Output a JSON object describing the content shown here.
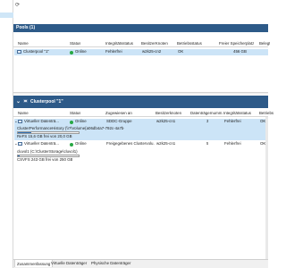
{
  "toolbar": {
    "refresh_icon": "refresh-icon"
  },
  "pools_panel": {
    "title": "Pools (1)",
    "columns": [
      "Name",
      "Status",
      "Integritätsstatus",
      "BesitzerKnoten",
      "Betriebsstatus",
      "Freier Speicherplatz",
      "Belegt"
    ],
    "rows": [
      {
        "name": "Clusterpool \"1\"",
        "status": "Online",
        "integrity": "Fehlerfrei",
        "owner": "w2k25-cn2",
        "opstatus": "OK",
        "free": "456 GB"
      }
    ]
  },
  "detail_panel": {
    "title": "Clusterpool \"1\"",
    "columns": [
      "Name",
      "Status",
      "Zugewiesen an",
      "Besitzerknoten",
      "Datenträgernumm...",
      "Integritätsstatus",
      "Betriebs"
    ],
    "disks": [
      {
        "name": "Virtueller Datenträ...",
        "status": "Online",
        "assigned": "SDDC-Gruppe",
        "owner": "w2k25-cn1",
        "number": "3",
        "integrity": "Fehlerfrei",
        "opstatus": "OK",
        "path": "ClusterPerformanceHistory (\\\\?\\Volume{a06db4a7-792c-4a7b-9cda-646cd7f5429c}\\)",
        "capacity_text": "ReFS 15,6 GB frei von 20,0 GB",
        "fill_fraction": 0.22
      },
      {
        "name": "Virtueller Datenträ...",
        "status": "Online",
        "assigned": "Freigegebenes Clustervolu...",
        "owner": "w2k25-cn1",
        "number": "5",
        "integrity": "Fehlerfrei",
        "opstatus": "OK",
        "path": "cluvol1 (C:\\ClusterStorage\\cluvol1)",
        "capacity_text": "CSVFS 243 GB frei von 250 GB",
        "fill_fraction": 0.03
      }
    ]
  },
  "tabs": [
    "Zusammenfassung",
    "Virtuelle Datenträger",
    "Physische Datenträger"
  ],
  "colors": {
    "accent": "#2d5a88",
    "selection": "#cce4f7",
    "ok": "#27a844"
  }
}
